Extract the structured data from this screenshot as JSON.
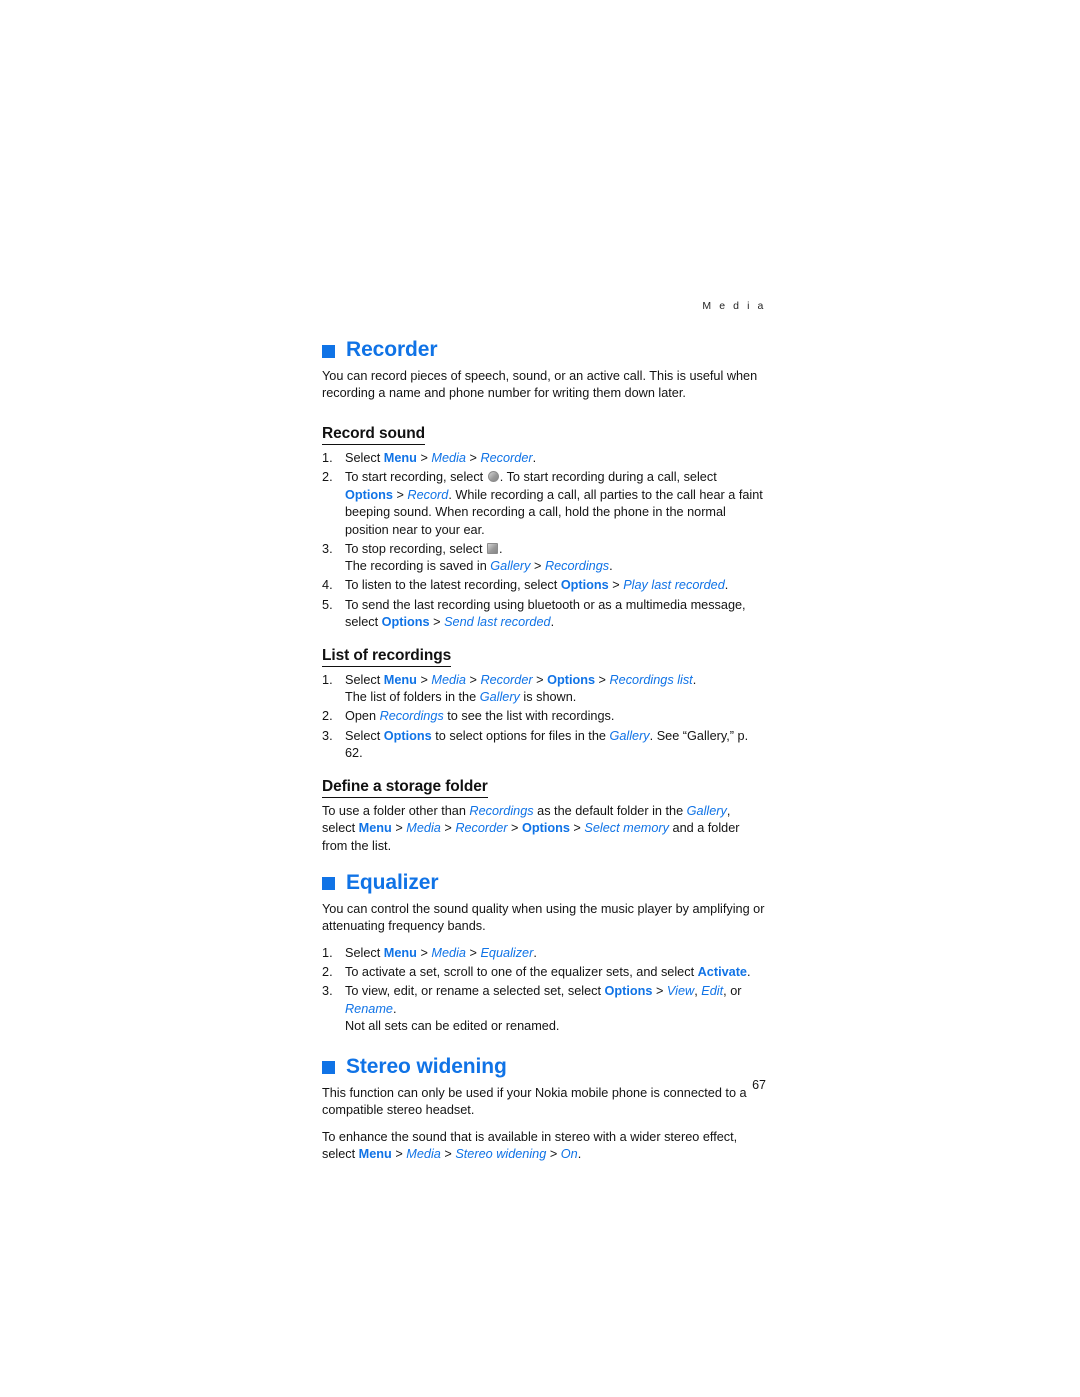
{
  "running_head": "M e d i a",
  "page_number": "67",
  "colors": {
    "link_blue": "#1073e6",
    "text_black": "#141414"
  },
  "sections": [
    {
      "title": "Recorder",
      "intro": "You can record pieces of speech, sound, or an active call. This is useful when recording a name and phone number for writing them down later.",
      "subsections": [
        {
          "title": "Record sound",
          "steps": [
            {
              "parts": [
                {
                  "t": "Select ",
                  "s": "plain"
                },
                {
                  "t": "Menu",
                  "s": "bold-blue"
                },
                {
                  "t": " > ",
                  "s": "sep"
                },
                {
                  "t": "Media",
                  "s": "italic-blue"
                },
                {
                  "t": " > ",
                  "s": "sep"
                },
                {
                  "t": "Recorder",
                  "s": "italic-blue"
                },
                {
                  "t": ".",
                  "s": "plain"
                }
              ]
            },
            {
              "parts": [
                {
                  "t": "To start recording, select ",
                  "s": "plain"
                },
                {
                  "t": "",
                  "s": "glyph-record"
                },
                {
                  "t": ". To start recording during a call, select ",
                  "s": "plain"
                },
                {
                  "t": "Options",
                  "s": "bold-blue"
                },
                {
                  "t": " > ",
                  "s": "sep"
                },
                {
                  "t": "Record",
                  "s": "italic-blue"
                },
                {
                  "t": ". While recording a call, all parties to the call hear a faint beeping sound. When recording a call, hold the phone in the normal position near to your ear.",
                  "s": "plain"
                }
              ]
            },
            {
              "parts": [
                {
                  "t": "To stop recording, select ",
                  "s": "plain"
                },
                {
                  "t": "",
                  "s": "glyph-stop"
                },
                {
                  "t": ".",
                  "s": "plain"
                }
              ],
              "continuation": [
                {
                  "t": "The recording is saved in ",
                  "s": "plain"
                },
                {
                  "t": "Gallery",
                  "s": "italic-blue"
                },
                {
                  "t": " > ",
                  "s": "sep"
                },
                {
                  "t": "Recordings",
                  "s": "italic-blue"
                },
                {
                  "t": ".",
                  "s": "plain"
                }
              ]
            },
            {
              "parts": [
                {
                  "t": "To listen to the latest recording, select ",
                  "s": "plain"
                },
                {
                  "t": "Options",
                  "s": "bold-blue"
                },
                {
                  "t": " > ",
                  "s": "sep"
                },
                {
                  "t": "Play last recorded",
                  "s": "italic-blue"
                },
                {
                  "t": ".",
                  "s": "plain"
                }
              ]
            },
            {
              "parts": [
                {
                  "t": "To send the last recording using bluetooth or as a multimedia message, select ",
                  "s": "plain"
                },
                {
                  "t": "Options",
                  "s": "bold-blue"
                },
                {
                  "t": " > ",
                  "s": "sep"
                },
                {
                  "t": "Send last recorded",
                  "s": "italic-blue"
                },
                {
                  "t": ".",
                  "s": "plain"
                }
              ]
            }
          ]
        },
        {
          "title": "List of recordings",
          "steps": [
            {
              "parts": [
                {
                  "t": "Select ",
                  "s": "plain"
                },
                {
                  "t": "Menu",
                  "s": "bold-blue"
                },
                {
                  "t": " > ",
                  "s": "sep"
                },
                {
                  "t": "Media",
                  "s": "italic-blue"
                },
                {
                  "t": " > ",
                  "s": "sep"
                },
                {
                  "t": "Recorder",
                  "s": "italic-blue"
                },
                {
                  "t": " > ",
                  "s": "sep"
                },
                {
                  "t": "Options",
                  "s": "bold-blue"
                },
                {
                  "t": " > ",
                  "s": "sep"
                },
                {
                  "t": "Recordings list",
                  "s": "italic-blue"
                },
                {
                  "t": ".",
                  "s": "plain"
                }
              ],
              "continuation": [
                {
                  "t": "The list of folders in the ",
                  "s": "plain"
                },
                {
                  "t": "Gallery",
                  "s": "italic-blue"
                },
                {
                  "t": " is shown.",
                  "s": "plain"
                }
              ]
            },
            {
              "parts": [
                {
                  "t": "Open ",
                  "s": "plain"
                },
                {
                  "t": "Recordings",
                  "s": "italic-blue"
                },
                {
                  "t": " to see the list with recordings.",
                  "s": "plain"
                }
              ]
            },
            {
              "parts": [
                {
                  "t": "Select ",
                  "s": "plain"
                },
                {
                  "t": "Options",
                  "s": "bold-blue"
                },
                {
                  "t": " to select options for files in the ",
                  "s": "plain"
                },
                {
                  "t": "Gallery",
                  "s": "italic-blue"
                },
                {
                  "t": ". See “Gallery,” p. 62.",
                  "s": "plain"
                }
              ]
            }
          ]
        },
        {
          "title": "Define a storage folder",
          "paragraph": [
            {
              "t": "To use a folder other than ",
              "s": "plain"
            },
            {
              "t": "Recordings",
              "s": "italic-blue"
            },
            {
              "t": " as the default folder in the ",
              "s": "plain"
            },
            {
              "t": "Gallery",
              "s": "italic-blue"
            },
            {
              "t": ", select ",
              "s": "plain"
            },
            {
              "t": "Menu",
              "s": "bold-blue"
            },
            {
              "t": " > ",
              "s": "sep"
            },
            {
              "t": "Media",
              "s": "italic-blue"
            },
            {
              "t": " > ",
              "s": "sep"
            },
            {
              "t": "Recorder",
              "s": "italic-blue"
            },
            {
              "t": " > ",
              "s": "sep"
            },
            {
              "t": "Options",
              "s": "bold-blue"
            },
            {
              "t": " > ",
              "s": "sep"
            },
            {
              "t": "Select memory",
              "s": "italic-blue"
            },
            {
              "t": " and a folder from the list.",
              "s": "plain"
            }
          ]
        }
      ]
    },
    {
      "title": "Equalizer",
      "intro": "You can control the sound quality when using the music player by amplifying or attenuating frequency bands.",
      "steps": [
        {
          "parts": [
            {
              "t": "Select ",
              "s": "plain"
            },
            {
              "t": "Menu",
              "s": "bold-blue"
            },
            {
              "t": " > ",
              "s": "sep"
            },
            {
              "t": "Media",
              "s": "italic-blue"
            },
            {
              "t": " > ",
              "s": "sep"
            },
            {
              "t": "Equalizer",
              "s": "italic-blue"
            },
            {
              "t": ".",
              "s": "plain"
            }
          ]
        },
        {
          "parts": [
            {
              "t": "To activate a set, scroll to one of the equalizer sets, and select ",
              "s": "plain"
            },
            {
              "t": "Activate",
              "s": "bold-blue"
            },
            {
              "t": ".",
              "s": "plain"
            }
          ]
        },
        {
          "parts": [
            {
              "t": "To view, edit, or rename a selected set, select ",
              "s": "plain"
            },
            {
              "t": "Options",
              "s": "bold-blue"
            },
            {
              "t": " > ",
              "s": "sep"
            },
            {
              "t": "View",
              "s": "italic-blue"
            },
            {
              "t": ", ",
              "s": "plain"
            },
            {
              "t": "Edit",
              "s": "italic-blue"
            },
            {
              "t": ", or ",
              "s": "plain"
            },
            {
              "t": "Rename",
              "s": "italic-blue"
            },
            {
              "t": ".",
              "s": "plain"
            }
          ],
          "continuation": [
            {
              "t": "Not all sets can be edited or renamed.",
              "s": "plain"
            }
          ]
        }
      ]
    },
    {
      "title": "Stereo widening",
      "intro": "This function can only be used if your Nokia mobile phone is connected to a compatible stereo headset.",
      "paragraph": [
        {
          "t": "To enhance the sound that is available in stereo with a wider stereo effect, select ",
          "s": "plain"
        },
        {
          "t": "Menu",
          "s": "bold-blue"
        },
        {
          "t": " > ",
          "s": "sep"
        },
        {
          "t": "Media",
          "s": "italic-blue"
        },
        {
          "t": " > ",
          "s": "sep"
        },
        {
          "t": "Stereo widening",
          "s": "italic-blue"
        },
        {
          "t": " > ",
          "s": "sep"
        },
        {
          "t": "On",
          "s": "italic-blue"
        },
        {
          "t": ".",
          "s": "plain"
        }
      ]
    }
  ]
}
